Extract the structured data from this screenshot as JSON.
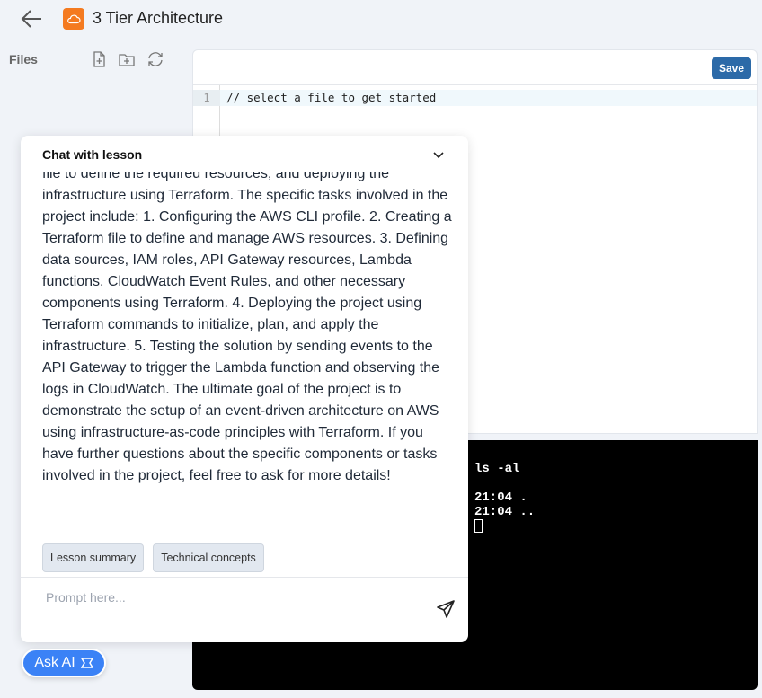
{
  "header": {
    "title": "3 Tier Architecture",
    "brand_color": "#f47a20"
  },
  "files": {
    "label": "Files",
    "icons": [
      "file-plus-icon",
      "folder-plus-icon",
      "refresh-icon"
    ]
  },
  "editor": {
    "save_label": "Save",
    "line_number": "1",
    "code": "// select a file to get started"
  },
  "terminal": {
    "lines": [
      "ls -al",
      "21:04 .",
      "21:04 .."
    ]
  },
  "chat": {
    "title": "Chat with lesson",
    "message": "file to define the required resources, and deploying the infrastructure using Terraform. The specific tasks involved in the project include: 1. Configuring the AWS CLI profile. 2. Creating a Terraform file to define and manage AWS resources. 3. Defining data sources, IAM roles, API Gateway resources, Lambda functions, CloudWatch Event Rules, and other necessary components using Terraform. 4. Deploying the project using Terraform commands to initialize, plan, and apply the infrastructure. 5. Testing the solution by sending events to the API Gateway to trigger the Lambda function and observing the logs in CloudWatch. The ultimate goal of the project is to demonstrate the setup of an event-driven architecture on AWS using infrastructure-as-code principles with Terraform. If you have further questions about the specific components or tasks involved in the project, feel free to ask for more details!",
    "chips": [
      "Lesson summary",
      "Technical concepts"
    ],
    "prompt_placeholder": "Prompt here..."
  },
  "ask_ai": {
    "label": "Ask AI",
    "color": "#3b82f6"
  }
}
